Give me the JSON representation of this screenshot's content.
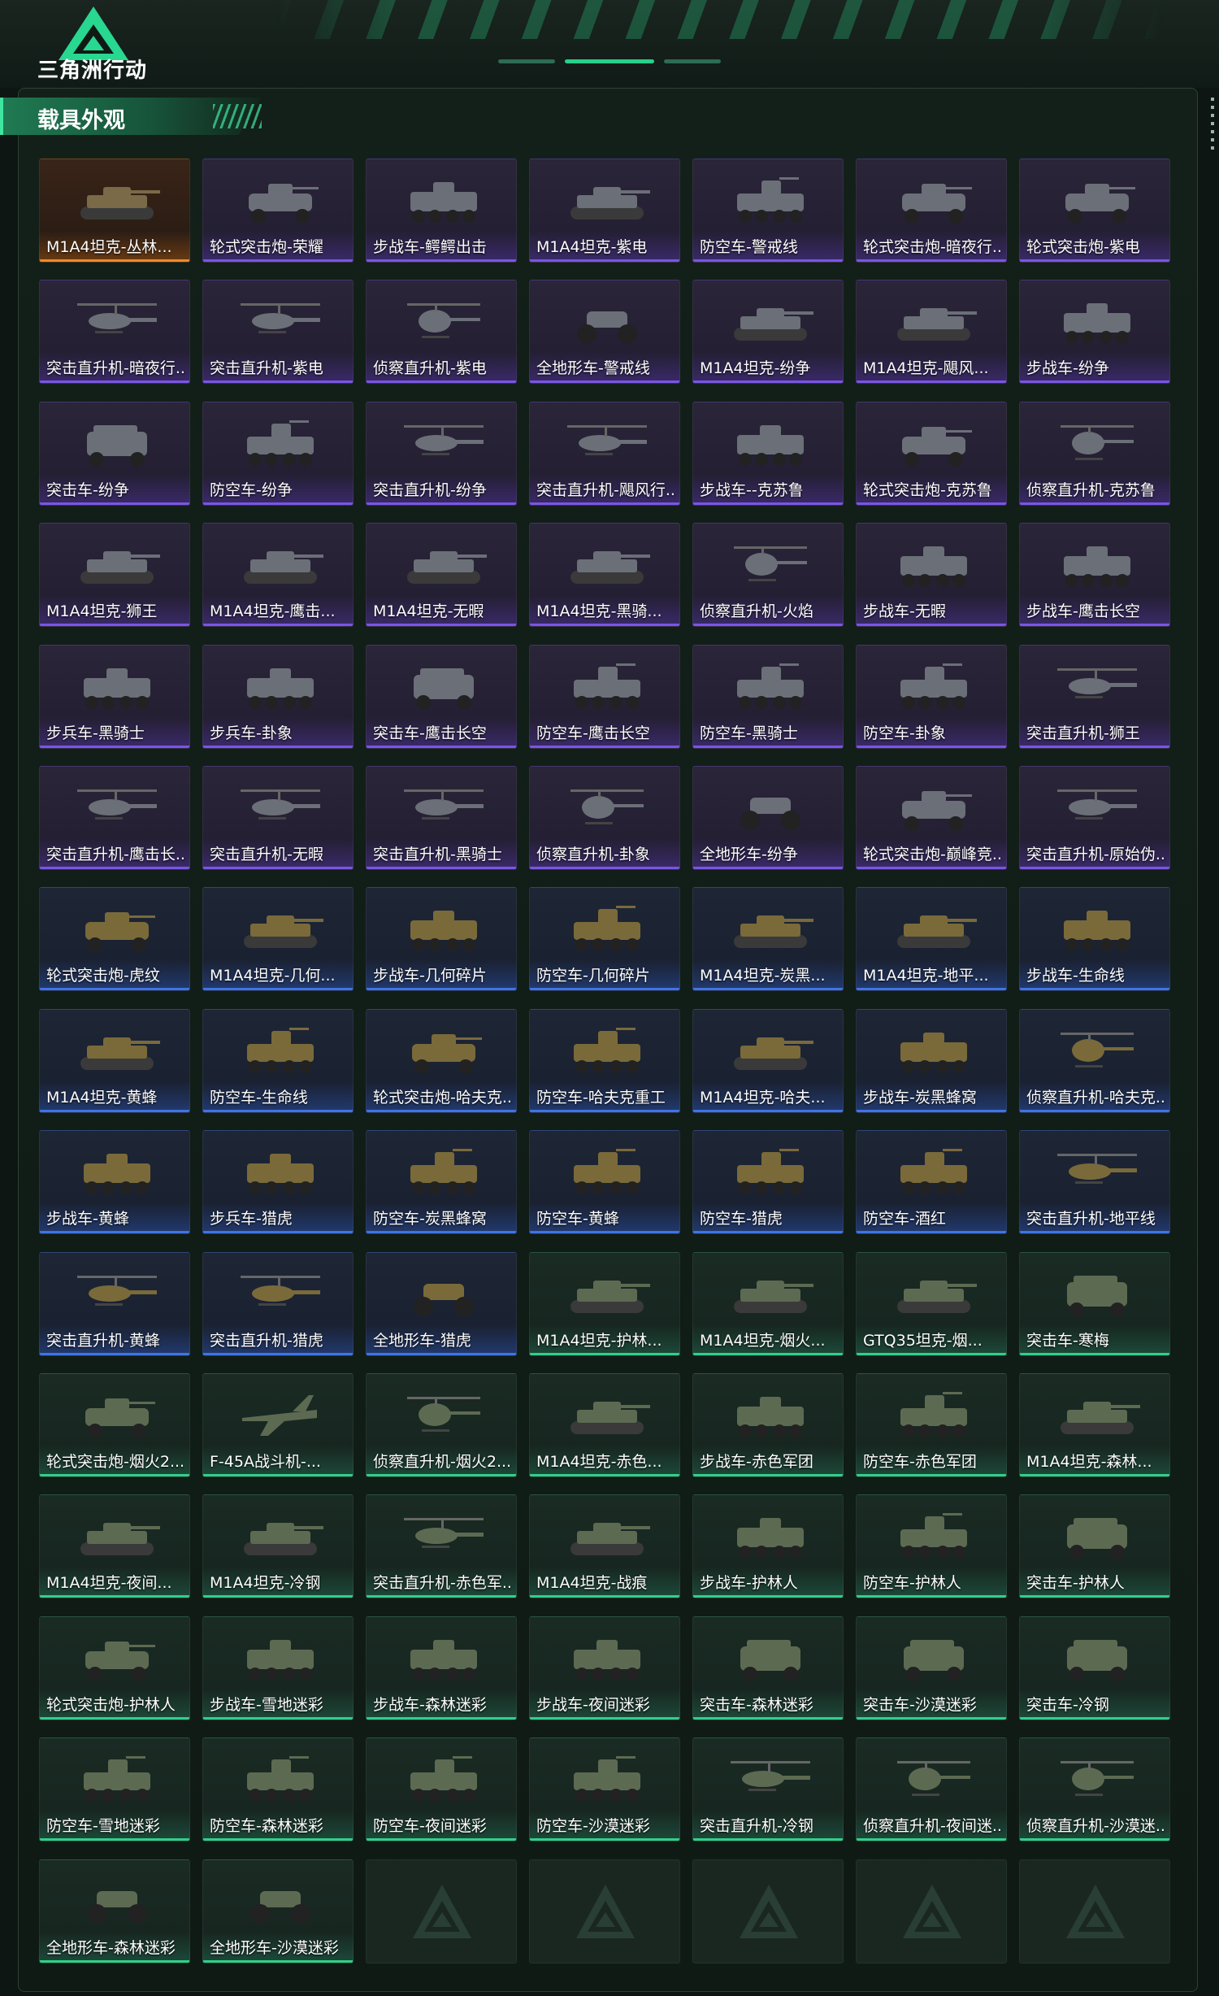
{
  "header": {
    "logo_text": "三角洲行动"
  },
  "section": {
    "title": "载具外观"
  },
  "colors": {
    "purple": "#7a55e6",
    "orange": "#f08a25",
    "blue": "#3f74e6",
    "green": "#2fd08a"
  },
  "items": [
    {
      "label": "M1A4坦克-丛林...",
      "tier": "orange",
      "icon": "tank-icon"
    },
    {
      "label": "轮式突击炮-荣耀",
      "tier": "purple",
      "icon": "wheeled-assault-gun-icon"
    },
    {
      "label": "步战车-鳄鳄出击",
      "tier": "purple",
      "icon": "ifv-icon"
    },
    {
      "label": "M1A4坦克-紫电",
      "tier": "purple",
      "icon": "tank-icon"
    },
    {
      "label": "防空车-警戒线",
      "tier": "purple",
      "icon": "aa-vehicle-icon"
    },
    {
      "label": "轮式突击炮-暗夜行...",
      "tier": "purple",
      "icon": "wheeled-assault-gun-icon"
    },
    {
      "label": "轮式突击炮-紫电",
      "tier": "purple",
      "icon": "wheeled-assault-gun-icon"
    },
    {
      "label": "突击直升机-暗夜行...",
      "tier": "purple",
      "icon": "attack-helicopter-icon"
    },
    {
      "label": "突击直升机-紫电",
      "tier": "purple",
      "icon": "attack-helicopter-icon"
    },
    {
      "label": "侦察直升机-紫电",
      "tier": "purple",
      "icon": "scout-helicopter-icon"
    },
    {
      "label": "全地形车-警戒线",
      "tier": "purple",
      "icon": "atv-icon"
    },
    {
      "label": "M1A4坦克-纷争",
      "tier": "purple",
      "icon": "tank-icon"
    },
    {
      "label": "M1A4坦克-飓风...",
      "tier": "purple",
      "icon": "tank-icon"
    },
    {
      "label": "步战车-纷争",
      "tier": "purple",
      "icon": "ifv-icon"
    },
    {
      "label": "突击车-纷争",
      "tier": "purple",
      "icon": "assault-car-icon"
    },
    {
      "label": "防空车-纷争",
      "tier": "purple",
      "icon": "aa-vehicle-icon"
    },
    {
      "label": "突击直升机-纷争",
      "tier": "purple",
      "icon": "attack-helicopter-icon"
    },
    {
      "label": "突击直升机-飓风行...",
      "tier": "purple",
      "icon": "attack-helicopter-icon"
    },
    {
      "label": "步战车--克苏鲁",
      "tier": "purple",
      "icon": "ifv-icon"
    },
    {
      "label": "轮式突击炮-克苏鲁",
      "tier": "purple",
      "icon": "wheeled-assault-gun-icon"
    },
    {
      "label": "侦察直升机-克苏鲁",
      "tier": "purple",
      "icon": "scout-helicopter-icon"
    },
    {
      "label": "M1A4坦克-狮王",
      "tier": "purple",
      "icon": "tank-icon"
    },
    {
      "label": "M1A4坦克-鹰击...",
      "tier": "purple",
      "icon": "tank-icon"
    },
    {
      "label": "M1A4坦克-无暇",
      "tier": "purple",
      "icon": "tank-icon"
    },
    {
      "label": "M1A4坦克-黑骑...",
      "tier": "purple",
      "icon": "tank-icon"
    },
    {
      "label": "侦察直升机-火焰",
      "tier": "purple",
      "icon": "scout-helicopter-icon"
    },
    {
      "label": "步战车-无暇",
      "tier": "purple",
      "icon": "ifv-icon"
    },
    {
      "label": "步战车-鹰击长空",
      "tier": "purple",
      "icon": "ifv-icon"
    },
    {
      "label": "步兵车-黑骑士",
      "tier": "purple",
      "icon": "ifv-icon"
    },
    {
      "label": "步兵车-卦象",
      "tier": "purple",
      "icon": "ifv-icon"
    },
    {
      "label": "突击车-鹰击长空",
      "tier": "purple",
      "icon": "assault-car-icon"
    },
    {
      "label": "防空车-鹰击长空",
      "tier": "purple",
      "icon": "aa-vehicle-icon"
    },
    {
      "label": "防空车-黑骑士",
      "tier": "purple",
      "icon": "aa-vehicle-icon"
    },
    {
      "label": "防空车-卦象",
      "tier": "purple",
      "icon": "aa-vehicle-icon"
    },
    {
      "label": "突击直升机-狮王",
      "tier": "purple",
      "icon": "attack-helicopter-icon"
    },
    {
      "label": "突击直升机-鹰击长...",
      "tier": "purple",
      "icon": "attack-helicopter-icon"
    },
    {
      "label": "突击直升机-无暇",
      "tier": "purple",
      "icon": "attack-helicopter-icon"
    },
    {
      "label": "突击直升机-黑骑士",
      "tier": "purple",
      "icon": "attack-helicopter-icon"
    },
    {
      "label": "侦察直升机-卦象",
      "tier": "purple",
      "icon": "scout-helicopter-icon"
    },
    {
      "label": "全地形车-纷争",
      "tier": "purple",
      "icon": "atv-icon"
    },
    {
      "label": "轮式突击炮-巅峰竞...",
      "tier": "purple",
      "icon": "wheeled-assault-gun-icon"
    },
    {
      "label": "突击直升机-原始伪...",
      "tier": "purple",
      "icon": "attack-helicopter-icon"
    },
    {
      "label": "轮式突击炮-虎纹",
      "tier": "blue",
      "icon": "wheeled-assault-gun-icon"
    },
    {
      "label": "M1A4坦克-几何...",
      "tier": "blue",
      "icon": "tank-icon"
    },
    {
      "label": "步战车-几何碎片",
      "tier": "blue",
      "icon": "ifv-icon"
    },
    {
      "label": "防空车-几何碎片",
      "tier": "blue",
      "icon": "aa-vehicle-icon"
    },
    {
      "label": "M1A4坦克-炭黑...",
      "tier": "blue",
      "icon": "tank-icon"
    },
    {
      "label": "M1A4坦克-地平...",
      "tier": "blue",
      "icon": "tank-icon"
    },
    {
      "label": "步战车-生命线",
      "tier": "blue",
      "icon": "ifv-icon"
    },
    {
      "label": "M1A4坦克-黄蜂",
      "tier": "blue",
      "icon": "tank-icon"
    },
    {
      "label": "防空车-生命线",
      "tier": "blue",
      "icon": "aa-vehicle-icon"
    },
    {
      "label": "轮式突击炮-哈夫克...",
      "tier": "blue",
      "icon": "wheeled-assault-gun-icon"
    },
    {
      "label": "防空车-哈夫克重工",
      "tier": "blue",
      "icon": "aa-vehicle-icon"
    },
    {
      "label": "M1A4坦克-哈夫...",
      "tier": "blue",
      "icon": "tank-icon"
    },
    {
      "label": "步战车-炭黑蜂窝",
      "tier": "blue",
      "icon": "ifv-icon"
    },
    {
      "label": "侦察直升机-哈夫克...",
      "tier": "blue",
      "icon": "scout-helicopter-icon"
    },
    {
      "label": "步战车-黄蜂",
      "tier": "blue",
      "icon": "ifv-icon"
    },
    {
      "label": "步兵车-猎虎",
      "tier": "blue",
      "icon": "ifv-icon"
    },
    {
      "label": "防空车-炭黑蜂窝",
      "tier": "blue",
      "icon": "aa-vehicle-icon"
    },
    {
      "label": "防空车-黄蜂",
      "tier": "blue",
      "icon": "aa-vehicle-icon"
    },
    {
      "label": "防空车-猎虎",
      "tier": "blue",
      "icon": "aa-vehicle-icon"
    },
    {
      "label": "防空车-酒红",
      "tier": "blue",
      "icon": "aa-vehicle-icon"
    },
    {
      "label": "突击直升机-地平线",
      "tier": "blue",
      "icon": "attack-helicopter-icon"
    },
    {
      "label": "突击直升机-黄蜂",
      "tier": "blue",
      "icon": "attack-helicopter-icon"
    },
    {
      "label": "突击直升机-猎虎",
      "tier": "blue",
      "icon": "attack-helicopter-icon"
    },
    {
      "label": "全地形车-猎虎",
      "tier": "blue",
      "icon": "atv-icon"
    },
    {
      "label": "M1A4坦克-护林...",
      "tier": "green",
      "icon": "tank-icon"
    },
    {
      "label": "M1A4坦克-烟火...",
      "tier": "green",
      "icon": "tank-icon"
    },
    {
      "label": "GTQ35坦克-烟...",
      "tier": "green",
      "icon": "tank-icon"
    },
    {
      "label": "突击车-寒梅",
      "tier": "green",
      "icon": "assault-car-icon"
    },
    {
      "label": "轮式突击炮-烟火2...",
      "tier": "green",
      "icon": "wheeled-assault-gun-icon"
    },
    {
      "label": "F-45A战斗机-...",
      "tier": "green",
      "icon": "fighter-jet-icon"
    },
    {
      "label": "侦察直升机-烟火2...",
      "tier": "green",
      "icon": "scout-helicopter-icon"
    },
    {
      "label": "M1A4坦克-赤色...",
      "tier": "green",
      "icon": "tank-icon"
    },
    {
      "label": "步战车-赤色军团",
      "tier": "green",
      "icon": "ifv-icon"
    },
    {
      "label": "防空车-赤色军团",
      "tier": "green",
      "icon": "aa-vehicle-icon"
    },
    {
      "label": "M1A4坦克-森林...",
      "tier": "green",
      "icon": "tank-icon"
    },
    {
      "label": "M1A4坦克-夜间...",
      "tier": "green",
      "icon": "tank-icon"
    },
    {
      "label": "M1A4坦克-冷钢",
      "tier": "green",
      "icon": "tank-icon"
    },
    {
      "label": "突击直升机-赤色军...",
      "tier": "green",
      "icon": "attack-helicopter-icon"
    },
    {
      "label": "M1A4坦克-战痕",
      "tier": "green",
      "icon": "tank-icon"
    },
    {
      "label": "步战车-护林人",
      "tier": "green",
      "icon": "ifv-icon"
    },
    {
      "label": "防空车-护林人",
      "tier": "green",
      "icon": "aa-vehicle-icon"
    },
    {
      "label": "突击车-护林人",
      "tier": "green",
      "icon": "assault-car-icon"
    },
    {
      "label": "轮式突击炮-护林人",
      "tier": "green",
      "icon": "wheeled-assault-gun-icon"
    },
    {
      "label": "步战车-雪地迷彩",
      "tier": "green",
      "icon": "ifv-icon"
    },
    {
      "label": "步战车-森林迷彩",
      "tier": "green",
      "icon": "ifv-icon"
    },
    {
      "label": "步战车-夜间迷彩",
      "tier": "green",
      "icon": "ifv-icon"
    },
    {
      "label": "突击车-森林迷彩",
      "tier": "green",
      "icon": "assault-car-icon"
    },
    {
      "label": "突击车-沙漠迷彩",
      "tier": "green",
      "icon": "assault-car-icon"
    },
    {
      "label": "突击车-冷钢",
      "tier": "green",
      "icon": "assault-car-icon"
    },
    {
      "label": "防空车-雪地迷彩",
      "tier": "green",
      "icon": "aa-vehicle-icon"
    },
    {
      "label": "防空车-森林迷彩",
      "tier": "green",
      "icon": "aa-vehicle-icon"
    },
    {
      "label": "防空车-夜间迷彩",
      "tier": "green",
      "icon": "aa-vehicle-icon"
    },
    {
      "label": "防空车-沙漠迷彩",
      "tier": "green",
      "icon": "aa-vehicle-icon"
    },
    {
      "label": "突击直升机-冷钢",
      "tier": "green",
      "icon": "attack-helicopter-icon"
    },
    {
      "label": "侦察直升机-夜间迷...",
      "tier": "green",
      "icon": "scout-helicopter-icon"
    },
    {
      "label": "侦察直升机-沙漠迷...",
      "tier": "green",
      "icon": "scout-helicopter-icon"
    },
    {
      "label": "全地形车-森林迷彩",
      "tier": "green",
      "icon": "atv-icon"
    },
    {
      "label": "全地形车-沙漠迷彩",
      "tier": "green",
      "icon": "atv-icon"
    },
    {
      "label": "",
      "tier": "empty",
      "icon": "empty-slot-icon"
    },
    {
      "label": "",
      "tier": "empty",
      "icon": "empty-slot-icon"
    },
    {
      "label": "",
      "tier": "empty",
      "icon": "empty-slot-icon"
    },
    {
      "label": "",
      "tier": "empty",
      "icon": "empty-slot-icon"
    },
    {
      "label": "",
      "tier": "empty",
      "icon": "empty-slot-icon"
    }
  ]
}
